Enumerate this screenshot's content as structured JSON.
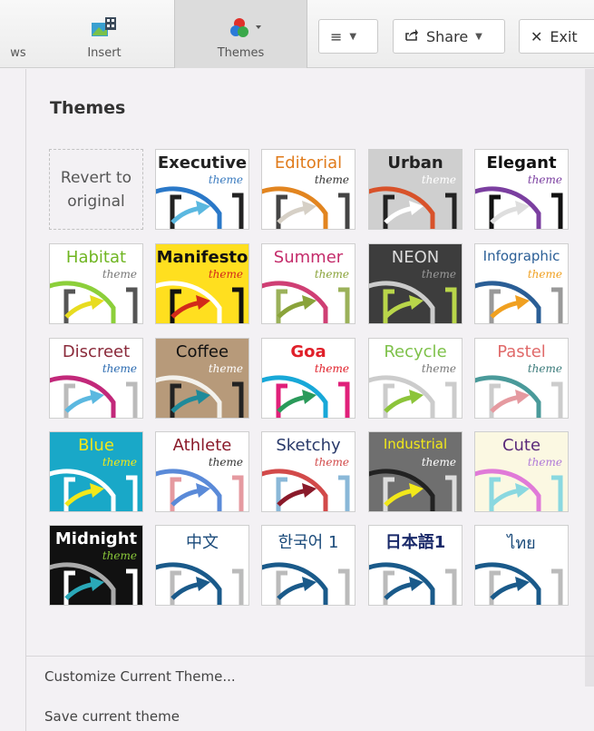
{
  "toolbar": {
    "cut_label": "ws",
    "insert_label": "Insert",
    "themes_label": "Themes",
    "menu_button": "≡",
    "share_label": "Share",
    "exit_label": "Exit"
  },
  "panel": {
    "title": "Themes",
    "revert_label": "Revert to original",
    "customize_label": "Customize Current Theme...",
    "save_label": "Save current theme"
  },
  "themes": [
    {
      "name": "Executive",
      "sub": "theme",
      "bg": "#ffffff",
      "title_color": "#222222",
      "sub_color": "#3a7bbf",
      "arc": "#2a78c8",
      "arrow": "#5bb8e0",
      "bracket": "#222222",
      "bold": true
    },
    {
      "name": "Editorial",
      "sub": "theme",
      "bg": "#ffffff",
      "title_color": "#e07b1b",
      "sub_color": "#333333",
      "arc": "#e28520",
      "arrow": "#d6d0c6",
      "bracket": "#444444",
      "bold": false
    },
    {
      "name": "Urban",
      "sub": "theme",
      "bg": "#cfcfcf",
      "title_color": "#222222",
      "sub_color": "#ffffff",
      "arc": "#d8522a",
      "arrow": "#ffffff",
      "bracket": "#222222",
      "bold": true
    },
    {
      "name": "Elegant",
      "sub": "theme",
      "bg": "#ffffff",
      "title_color": "#111111",
      "sub_color": "#7b3fa0",
      "arc": "#7b3fa0",
      "arrow": "#dedede",
      "bracket": "#111111",
      "bold": true
    },
    {
      "name": "Habitat",
      "sub": "theme",
      "bg": "#ffffff",
      "title_color": "#6fb521",
      "sub_color": "#777777",
      "arc": "#8ccf3a",
      "arrow": "#e8dc20",
      "bracket": "#555555",
      "bold": false
    },
    {
      "name": "Manifesto",
      "sub": "theme",
      "bg": "#ffdf1f",
      "title_color": "#111111",
      "sub_color": "#d22a1a",
      "arc": "#ffffff",
      "arrow": "#d22a1a",
      "bracket": "#111111",
      "bold": true
    },
    {
      "name": "Summer",
      "sub": "theme",
      "bg": "#ffffff",
      "title_color": "#c42b6a",
      "sub_color": "#8aa33a",
      "arc": "#cf3f74",
      "arrow": "#8aa33a",
      "bracket": "#9bb15a",
      "bold": false
    },
    {
      "name": "NEON",
      "sub": "theme",
      "bg": "#3d3d3d",
      "title_color": "#dddddd",
      "sub_color": "#999999",
      "arc": "#cccccc",
      "arrow": "#b9d64a",
      "bracket": "#b9d64a",
      "bold": false
    },
    {
      "name": "Infographic",
      "sub": "theme",
      "bg": "#ffffff",
      "title_color": "#2a5e96",
      "sub_color": "#f0a020",
      "arc": "#2a5e96",
      "arrow": "#f0a020",
      "bracket": "#999999",
      "bold": false
    },
    {
      "name": "Discreet",
      "sub": "theme",
      "bg": "#ffffff",
      "title_color": "#8a2a3a",
      "sub_color": "#2a6ab0",
      "arc": "#c2287a",
      "arrow": "#5bb8e0",
      "bracket": "#bbbbbb",
      "bold": false
    },
    {
      "name": "Coffee",
      "sub": "theme",
      "bg": "#b79a7a",
      "title_color": "#111111",
      "sub_color": "#ffffff",
      "arc": "#f3f1ec",
      "arrow": "#1f8a9a",
      "bracket": "#222222",
      "bold": false
    },
    {
      "name": "Goa",
      "sub": "theme",
      "bg": "#ffffff",
      "title_color": "#e0202a",
      "sub_color": "#e0202a",
      "arc": "#18a8d8",
      "arrow": "#2a9a5a",
      "bracket": "#e0207a",
      "bold": true
    },
    {
      "name": "Recycle",
      "sub": "theme",
      "bg": "#ffffff",
      "title_color": "#7ec14a",
      "sub_color": "#777777",
      "arc": "#cccccc",
      "arrow": "#8cc43a",
      "bracket": "#cccccc",
      "bold": false
    },
    {
      "name": "Pastel",
      "sub": "theme",
      "bg": "#ffffff",
      "title_color": "#e06a6a",
      "sub_color": "#3a7a7a",
      "arc": "#4a9a9a",
      "arrow": "#e59aa0",
      "bracket": "#cccccc",
      "bold": false
    },
    {
      "name": "Blue",
      "sub": "theme",
      "bg": "#19a8c8",
      "title_color": "#f2e81a",
      "sub_color": "#f2e81a",
      "arc": "#ffffff",
      "arrow": "#f2e81a",
      "bracket": "#ffffff",
      "bold": false
    },
    {
      "name": "Athlete",
      "sub": "theme",
      "bg": "#ffffff",
      "title_color": "#8a1a2a",
      "sub_color": "#333333",
      "arc": "#5a8ad8",
      "arrow": "#5a8ad8",
      "bracket": "#e59aa0",
      "bold": false
    },
    {
      "name": "Sketchy",
      "sub": "theme",
      "bg": "#ffffff",
      "title_color": "#2a3a6a",
      "sub_color": "#d24a4a",
      "arc": "#d24a4a",
      "arrow": "#8a1a2a",
      "bracket": "#8ab8d8",
      "bold": false
    },
    {
      "name": "Industrial",
      "sub": "theme",
      "bg": "#6f6f6f",
      "title_color": "#f2e81a",
      "sub_color": "#ffffff",
      "arc": "#222222",
      "arrow": "#f2e81a",
      "bracket": "#dddddd",
      "bold": false
    },
    {
      "name": "Cute",
      "sub": "theme",
      "bg": "#fbf8e2",
      "title_color": "#5a2a7a",
      "sub_color": "#b07ad8",
      "arc": "#e07ad8",
      "arrow": "#8ad8e0",
      "bracket": "#8ad8e0",
      "bold": false
    },
    {
      "name": "Midnight",
      "sub": "theme",
      "bg": "#111111",
      "title_color": "#ffffff",
      "sub_color": "#8ac83a",
      "arc": "#aaaaaa",
      "arrow": "#2aa8b8",
      "bracket": "#ffffff",
      "bold": true
    },
    {
      "name": "中文",
      "sub": "",
      "bg": "#ffffff",
      "title_color": "#1a4a7a",
      "sub_color": "#1a4a7a",
      "arc": "#1a5a8a",
      "arrow": "#1a5a8a",
      "bracket": "#bbbbbb",
      "bold": false
    },
    {
      "name": "한국어 1",
      "sub": "",
      "bg": "#ffffff",
      "title_color": "#1a4a7a",
      "sub_color": "#1a4a7a",
      "arc": "#1a5a8a",
      "arrow": "#1a5a8a",
      "bracket": "#bbbbbb",
      "bold": false
    },
    {
      "name": "日本語1",
      "sub": "",
      "bg": "#ffffff",
      "title_color": "#1a2a6a",
      "sub_color": "#1a4a7a",
      "arc": "#1a5a8a",
      "arrow": "#1a5a8a",
      "bracket": "#bbbbbb",
      "bold": true
    },
    {
      "name": "ไทย",
      "sub": "",
      "bg": "#ffffff",
      "title_color": "#1a4a7a",
      "sub_color": "#1a4a7a",
      "arc": "#1a5a8a",
      "arrow": "#1a5a8a",
      "bracket": "#bbbbbb",
      "bold": false
    }
  ]
}
